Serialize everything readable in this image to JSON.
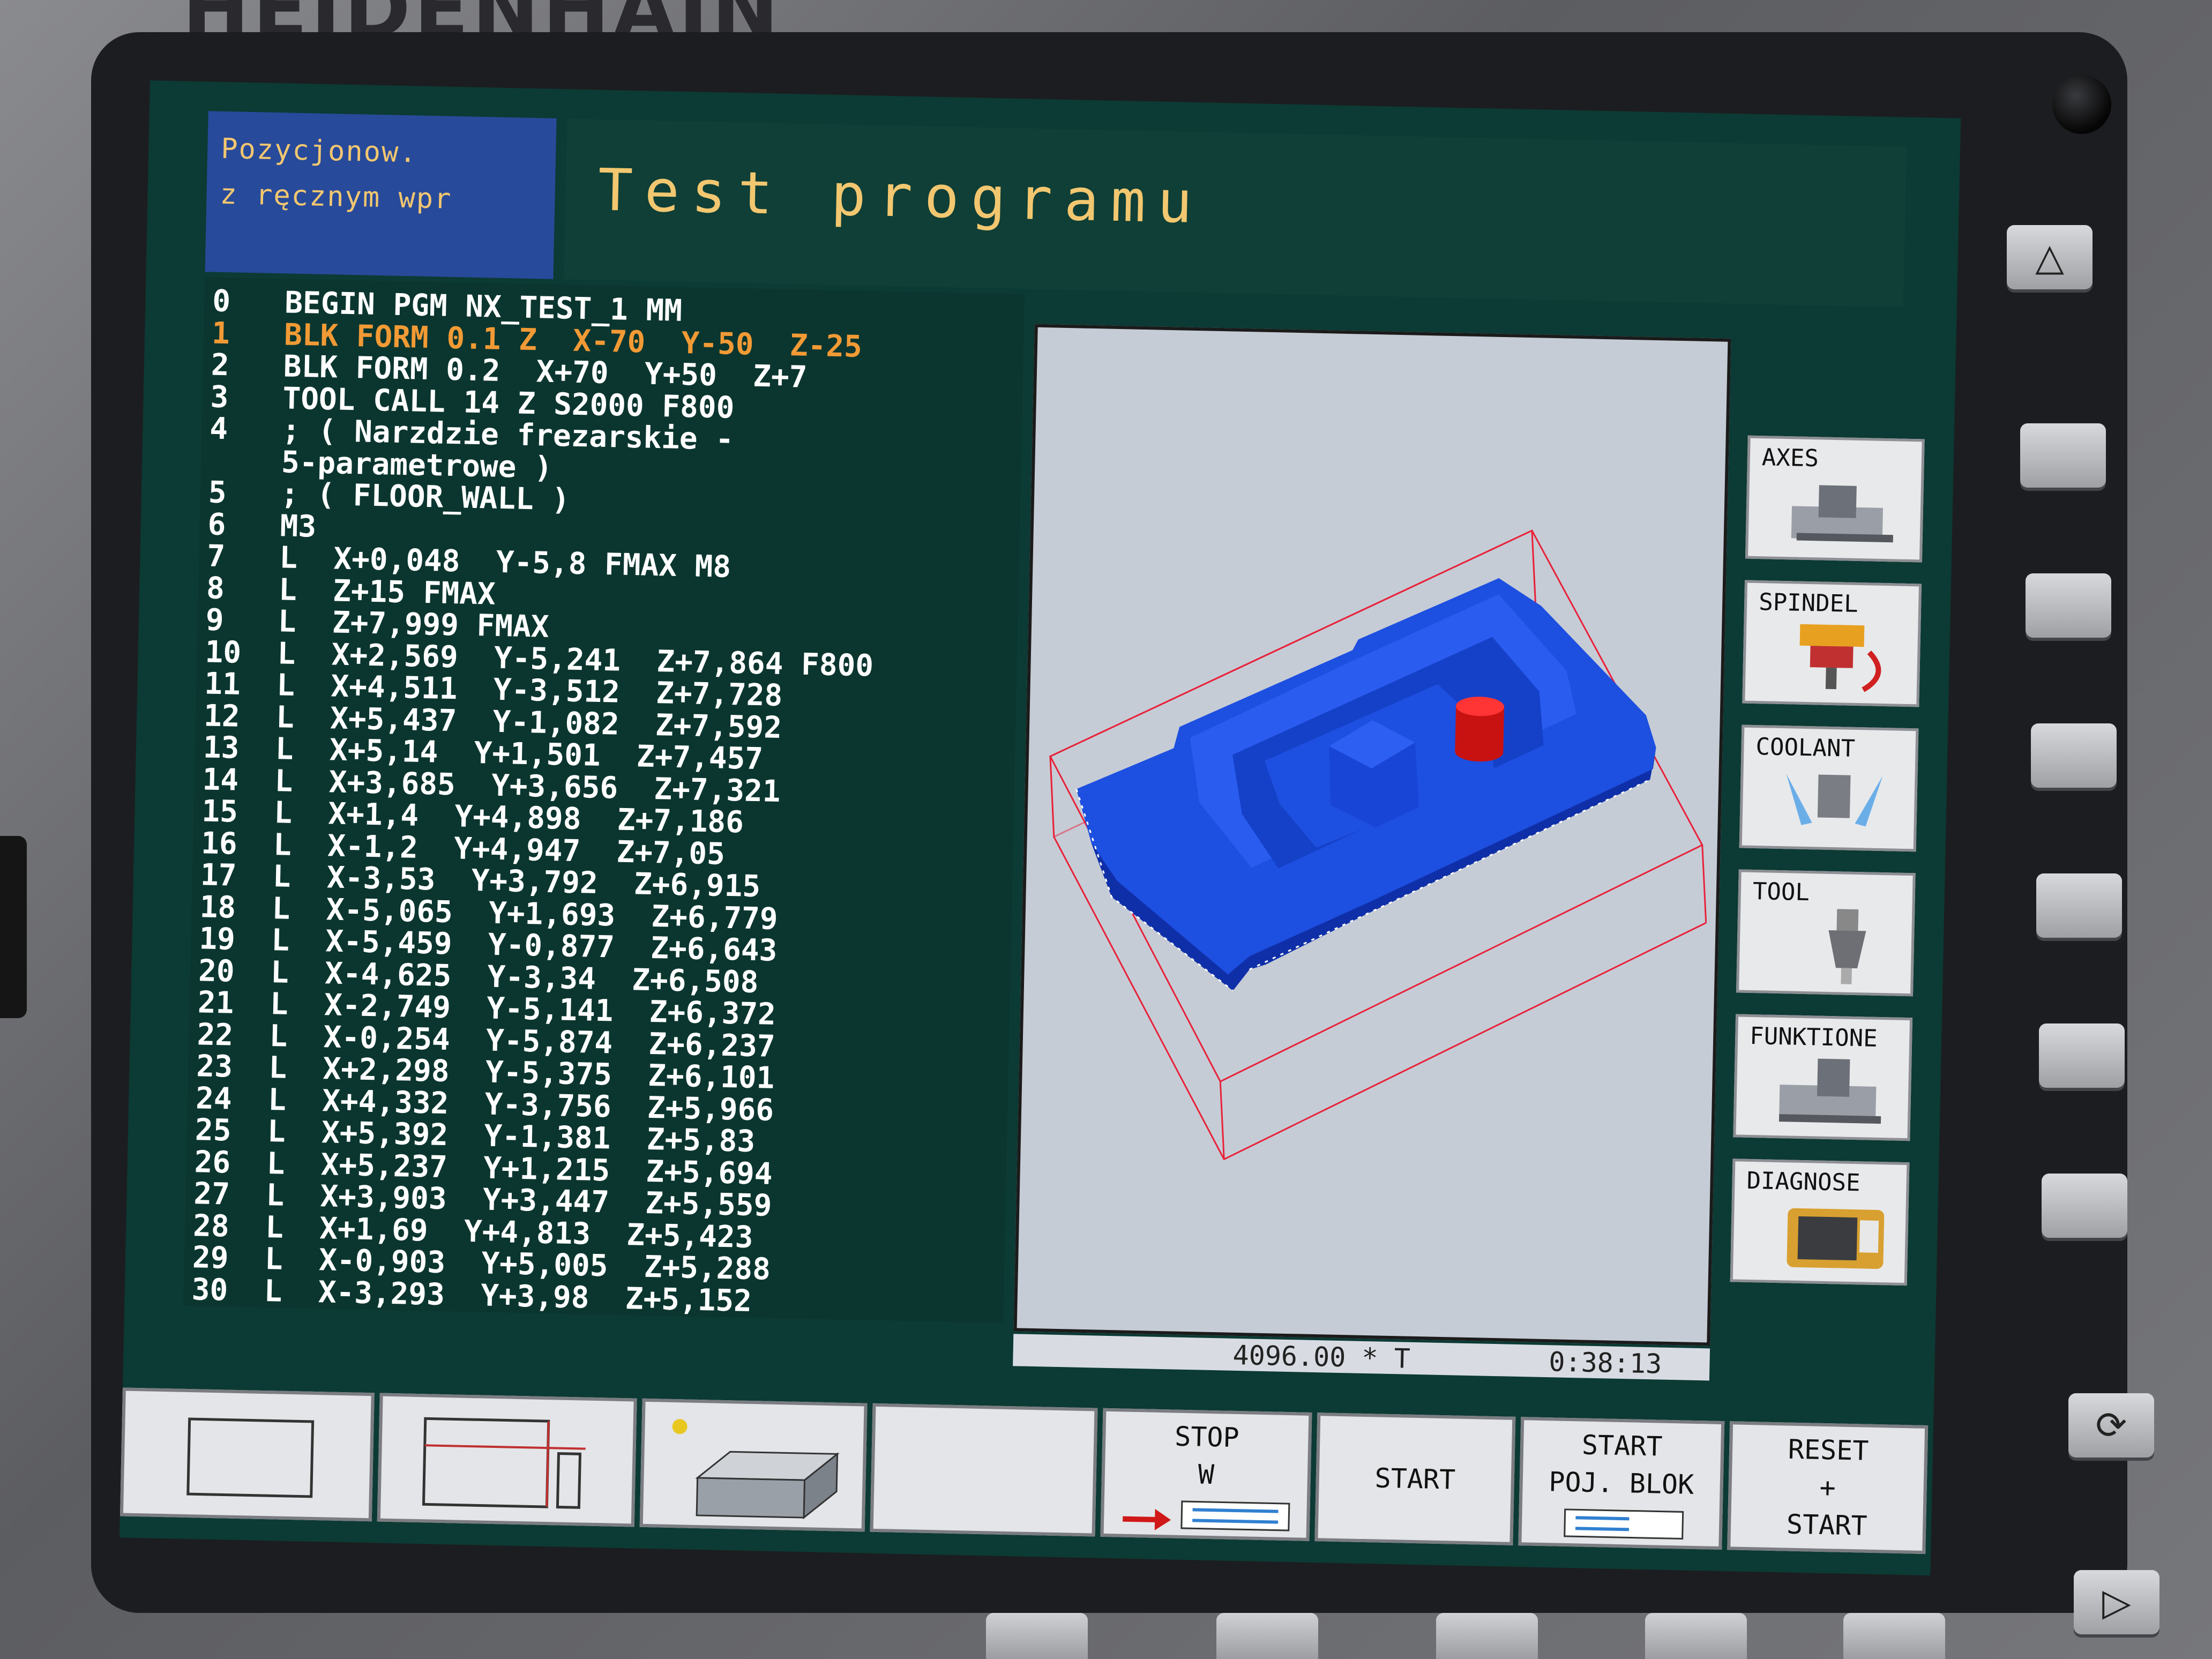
{
  "brand": "HEIDENHAIN",
  "header": {
    "mode_line1": "Pozycjonow.",
    "mode_line2": "z ręcznym wpr",
    "title": "Test programu"
  },
  "program": {
    "lines": [
      {
        "n": "0",
        "t": "BEGIN PGM NX_TEST_1 MM"
      },
      {
        "n": "1",
        "t": "BLK FORM 0.1 Z  X-70  Y-50  Z-25"
      },
      {
        "n": "2",
        "t": "BLK FORM 0.2  X+70  Y+50  Z+7"
      },
      {
        "n": "3",
        "t": "TOOL CALL 14 Z S2000 F800"
      },
      {
        "n": "4",
        "t": "; ( Narzdzie frezarskie -"
      },
      {
        "n": "",
        "t": "5-parametrowe )"
      },
      {
        "n": "5",
        "t": "; ( FLOOR_WALL )"
      },
      {
        "n": "6",
        "t": "M3"
      },
      {
        "n": "7",
        "t": "L  X+0,048  Y-5,8 FMAX M8"
      },
      {
        "n": "8",
        "t": "L  Z+15 FMAX"
      },
      {
        "n": "9",
        "t": "L  Z+7,999 FMAX"
      },
      {
        "n": "10",
        "t": "L  X+2,569  Y-5,241  Z+7,864 F800"
      },
      {
        "n": "11",
        "t": "L  X+4,511  Y-3,512  Z+7,728"
      },
      {
        "n": "12",
        "t": "L  X+5,437  Y-1,082  Z+7,592"
      },
      {
        "n": "13",
        "t": "L  X+5,14  Y+1,501  Z+7,457"
      },
      {
        "n": "14",
        "t": "L  X+3,685  Y+3,656  Z+7,321"
      },
      {
        "n": "15",
        "t": "L  X+1,4  Y+4,898  Z+7,186"
      },
      {
        "n": "16",
        "t": "L  X-1,2  Y+4,947  Z+7,05"
      },
      {
        "n": "17",
        "t": "L  X-3,53  Y+3,792  Z+6,915"
      },
      {
        "n": "18",
        "t": "L  X-5,065  Y+1,693  Z+6,779"
      },
      {
        "n": "19",
        "t": "L  X-5,459  Y-0,877  Z+6,643"
      },
      {
        "n": "20",
        "t": "L  X-4,625  Y-3,34  Z+6,508"
      },
      {
        "n": "21",
        "t": "L  X-2,749  Y-5,141  Z+6,372"
      },
      {
        "n": "22",
        "t": "L  X-0,254  Y-5,874  Z+6,237"
      },
      {
        "n": "23",
        "t": "L  X+2,298  Y-5,375  Z+6,101"
      },
      {
        "n": "24",
        "t": "L  X+4,332  Y-3,756  Z+5,966"
      },
      {
        "n": "25",
        "t": "L  X+5,392  Y-1,381  Z+5,83"
      },
      {
        "n": "26",
        "t": "L  X+5,237  Y+1,215  Z+5,694"
      },
      {
        "n": "27",
        "t": "L  X+3,903  Y+3,447  Z+5,559"
      },
      {
        "n": "28",
        "t": "L  X+1,69  Y+4,813  Z+5,423"
      },
      {
        "n": "29",
        "t": "L  X-0,903  Y+5,005  Z+5,288"
      },
      {
        "n": "30",
        "t": "L  X-3,293  Y+3,98  Z+5,152"
      }
    ],
    "highlight_index": 1
  },
  "status": {
    "feed": "4096.00 * T",
    "time": "0:38:13"
  },
  "vertical_softkeys": [
    {
      "label": "AXES",
      "icon": "machine-axes-icon"
    },
    {
      "label": "SPINDEL",
      "icon": "spindle-icon"
    },
    {
      "label": "COOLANT",
      "icon": "coolant-icon"
    },
    {
      "label": "TOOL",
      "icon": "tool-holder-icon"
    },
    {
      "label": "FUNKTIONE",
      "icon": "machine-functions-icon"
    },
    {
      "label": "DIAGNOSE",
      "icon": "multimeter-icon"
    }
  ],
  "horizontal_softkeys": {
    "stop_line1": "STOP",
    "stop_line2": "W",
    "start": "START",
    "start_block_line1": "START",
    "start_block_line2": "POJ. BLOK",
    "reset_line1": "RESET",
    "reset_line2": "+",
    "reset_line3": "START"
  },
  "colors": {
    "screen_bg": "#0c3a34",
    "mode_bg": "#284a9a",
    "accent_text": "#f2c770",
    "highlight_text": "#f29a35",
    "workpiece": "#1d4fe0",
    "tool": "#e01a1a"
  }
}
